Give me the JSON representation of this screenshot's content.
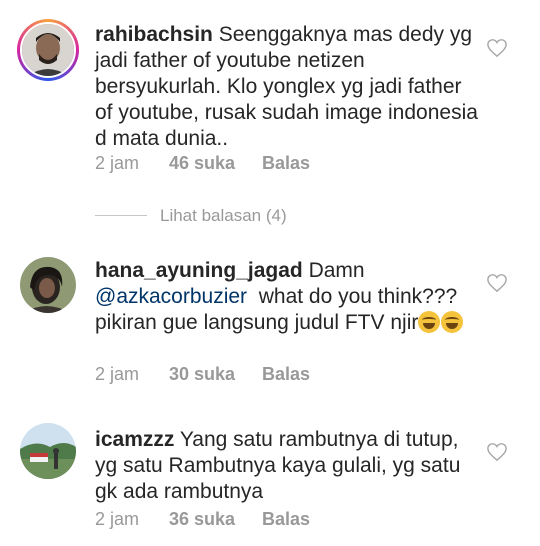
{
  "comments": [
    {
      "username": "rahibachsin",
      "text": "Seenggaknya mas dedy yg jadi father of youtube netizen bersyukurlah. Klo yonglex yg jadi father of youtube, rusak sudah image indonesia d mata dunia..",
      "time": "2 jam",
      "likes": "46 suka",
      "reply": "Balas",
      "view_replies": "Lihat balasan (4)",
      "avatar_icon": "user-photo-icon"
    },
    {
      "username": "hana_ayuning_jagad",
      "text_a": "Damn",
      "mention": "@azkacorbuzier",
      "text_b": "what do you think??? pikiran gue langsung judul FTV njir",
      "emoji": "face-with-tears-of-joy-icon",
      "time": "2 jam",
      "likes": "30 suka",
      "reply": "Balas",
      "avatar_icon": "user-photo-icon"
    },
    {
      "username": "icamzzz",
      "text": "Yang satu rambutnya di tutup, yg satu Rambutnya kaya gulali, yg satu gk ada rambutnya",
      "time": "2 jam",
      "likes": "36 suka",
      "reply": "Balas",
      "avatar_icon": "user-photo-icon"
    }
  ],
  "icons": {
    "like": "heart-outline-icon"
  },
  "colors": {
    "text": "#262626",
    "muted": "#999999",
    "mention": "#003569"
  }
}
